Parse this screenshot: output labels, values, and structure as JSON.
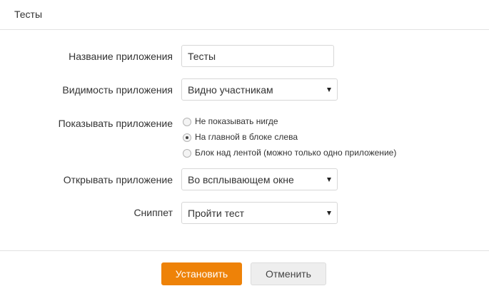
{
  "header": {
    "title": "Тесты"
  },
  "form": {
    "name": {
      "label": "Название приложения",
      "value": "Тесты"
    },
    "visibility": {
      "label": "Видимость приложения",
      "value": "Видно участникам"
    },
    "show": {
      "label": "Показывать приложение",
      "options": [
        {
          "label": "Не показывать нигде",
          "selected": false
        },
        {
          "label": "На главной в блоке слева",
          "selected": true
        },
        {
          "label": "Блок над лентой (можно только одно приложение)",
          "selected": false
        }
      ]
    },
    "open": {
      "label": "Открывать приложение",
      "value": "Во всплывающем окне"
    },
    "snippet": {
      "label": "Сниппет",
      "value": "Пройти тест"
    }
  },
  "footer": {
    "install_label": "Установить",
    "cancel_label": "Отменить"
  },
  "colors": {
    "accent": "#ee8208",
    "divider": "#e2e2e2"
  }
}
